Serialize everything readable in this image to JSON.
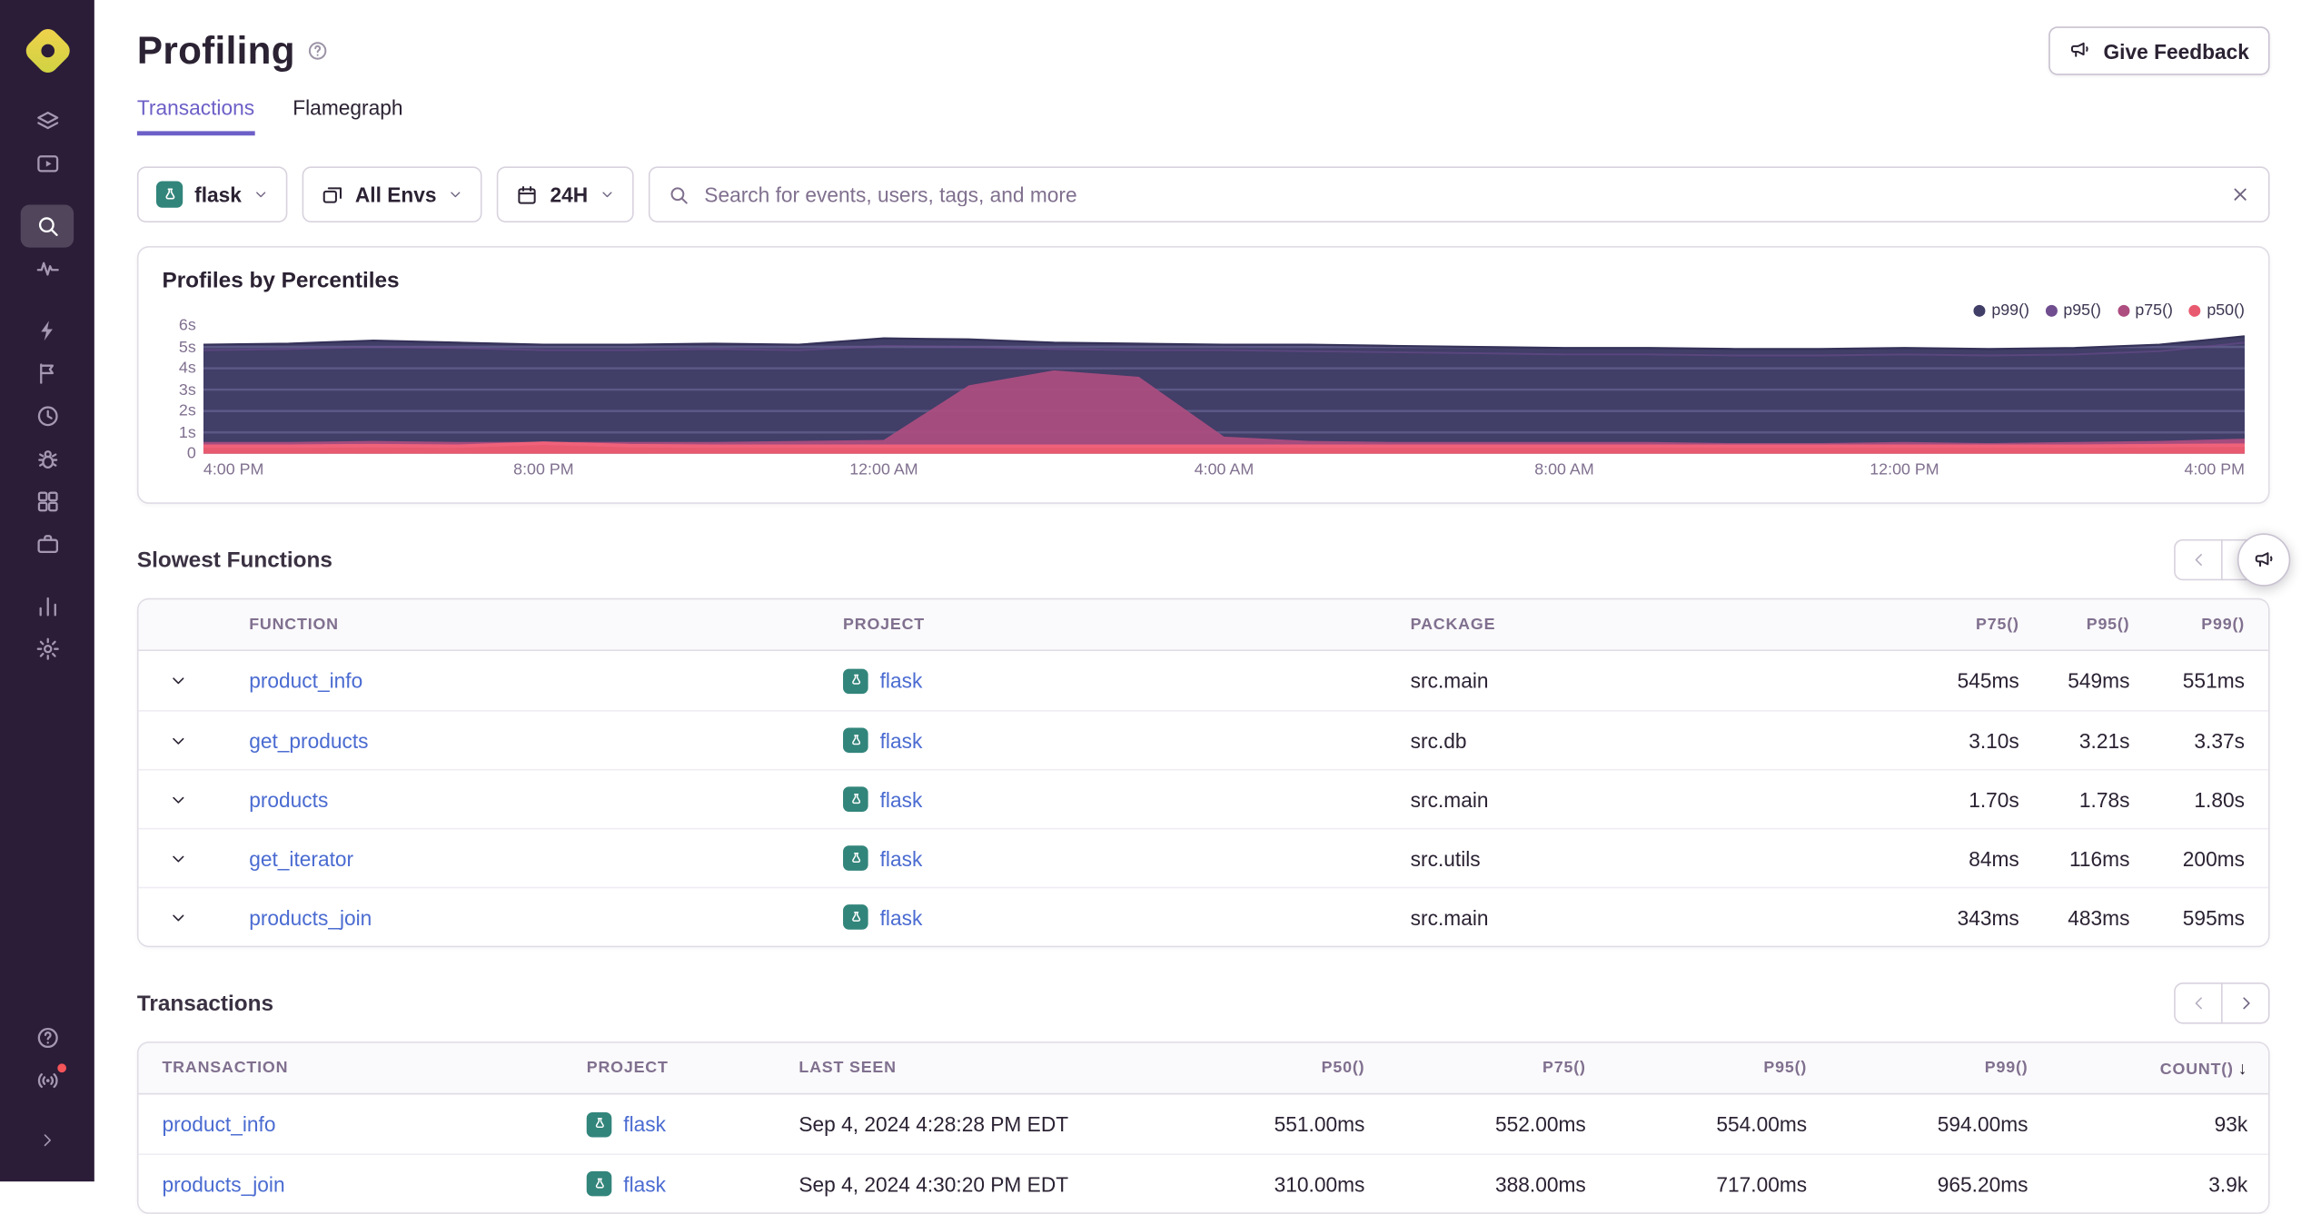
{
  "colors": {
    "accent_purple": "#6C5FC7",
    "link_blue": "#4a6bd1",
    "flask_teal": "#32857b",
    "sidebar_bg": "#2b1d38",
    "alert_red": "#f55459"
  },
  "sidebar": {
    "active_item": "search",
    "items": [
      {
        "name": "issues",
        "icon": "layers-icon"
      },
      {
        "name": "explore",
        "icon": "monitor-play-icon"
      },
      {
        "name": "search",
        "icon": "search-icon"
      },
      {
        "name": "traces",
        "icon": "waveform-icon"
      },
      {
        "name": "alerts",
        "icon": "lightning-icon"
      },
      {
        "name": "feedback",
        "icon": "flag-icon"
      },
      {
        "name": "crons",
        "icon": "clock-icon"
      },
      {
        "name": "debug",
        "icon": "bug-icon"
      },
      {
        "name": "dashboards",
        "icon": "grid-icon"
      },
      {
        "name": "projects",
        "icon": "briefcase-icon"
      },
      {
        "name": "stats",
        "icon": "bar-chart-icon"
      },
      {
        "name": "settings",
        "icon": "gear-icon"
      }
    ],
    "bottom_items": [
      {
        "name": "help",
        "icon": "question-circle-icon"
      },
      {
        "name": "whats-new",
        "icon": "broadcast-icon",
        "has_badge": true
      },
      {
        "name": "collapse",
        "icon": "chevron-right-icon"
      }
    ]
  },
  "header": {
    "title": "Profiling",
    "feedback_button_label": "Give Feedback"
  },
  "tabs": {
    "items": [
      {
        "label": "Transactions",
        "active": true
      },
      {
        "label": "Flamegraph",
        "active": false
      }
    ]
  },
  "filters": {
    "project_selector": {
      "value": "flask",
      "icon": "flask-project-icon"
    },
    "environment_selector": {
      "value": "All Envs",
      "icon": "windows-icon"
    },
    "date_selector": {
      "value": "24H",
      "icon": "calendar-icon"
    },
    "search": {
      "placeholder": "Search for events, users, tags, and more"
    }
  },
  "profiles_panel": {
    "title": "Profiles by Percentiles",
    "legend": [
      {
        "label": "p99()",
        "color": "#413E68"
      },
      {
        "label": "p95()",
        "color": "#6F4D8F"
      },
      {
        "label": "p75()",
        "color": "#AD4D80"
      },
      {
        "label": "p50()",
        "color": "#E85A6F"
      }
    ]
  },
  "chart_data": {
    "type": "area",
    "title": "Profiles by Percentiles",
    "x_ticks": [
      "4:00 PM",
      "8:00 PM",
      "12:00 AM",
      "4:00 AM",
      "8:00 AM",
      "12:00 PM",
      "4:00 PM"
    ],
    "y_ticks": [
      "6s",
      "5s",
      "4s",
      "3s",
      "2s",
      "1s",
      "0"
    ],
    "ylim_seconds": [
      0,
      6
    ],
    "x_unit": "hours, hourly samples over 24h",
    "series": [
      {
        "name": "p99()",
        "color": "#413E68",
        "unit": "s",
        "values": [
          5.1,
          5.15,
          5.3,
          5.2,
          5.1,
          5.1,
          5.15,
          5.1,
          5.4,
          5.35,
          5.2,
          5.15,
          5.1,
          5.1,
          5.05,
          5.0,
          4.95,
          4.95,
          4.9,
          4.9,
          4.95,
          4.9,
          4.95,
          5.1,
          5.5
        ]
      },
      {
        "name": "p95()",
        "color": "#6F4D8F",
        "unit": "s",
        "values": [
          4.85,
          4.9,
          5.0,
          4.95,
          4.85,
          4.85,
          4.9,
          4.85,
          5.05,
          5.0,
          4.9,
          4.85,
          4.85,
          4.8,
          4.75,
          4.7,
          4.65,
          4.65,
          4.6,
          4.6,
          4.65,
          4.6,
          4.65,
          4.8,
          5.2
        ]
      },
      {
        "name": "p75()",
        "color": "#AD4D80",
        "unit": "s",
        "values": [
          0.55,
          0.55,
          0.6,
          0.55,
          0.55,
          0.55,
          0.55,
          0.6,
          0.65,
          3.2,
          3.9,
          3.6,
          0.8,
          0.6,
          0.55,
          0.55,
          0.55,
          0.55,
          0.5,
          0.5,
          0.55,
          0.5,
          0.55,
          0.6,
          0.7
        ]
      },
      {
        "name": "p50()",
        "color": "#E85A6F",
        "unit": "s",
        "values": [
          0.35,
          0.35,
          0.38,
          0.35,
          0.5,
          0.38,
          0.35,
          0.35,
          0.35,
          0.35,
          0.35,
          0.35,
          0.35,
          0.35,
          0.35,
          0.35,
          0.35,
          0.35,
          0.35,
          0.35,
          0.35,
          0.35,
          0.35,
          0.38,
          0.4
        ]
      }
    ],
    "legend_position": "top-right",
    "grid": false
  },
  "slowest_functions": {
    "title": "Slowest Functions",
    "columns": [
      "FUNCTION",
      "PROJECT",
      "PACKAGE",
      "P75()",
      "P95()",
      "P99()"
    ],
    "rows": [
      {
        "function": "product_info",
        "project": "flask",
        "package": "src.main",
        "p75": "545ms",
        "p95": "549ms",
        "p99": "551ms"
      },
      {
        "function": "get_products",
        "project": "flask",
        "package": "src.db",
        "p75": "3.10s",
        "p95": "3.21s",
        "p99": "3.37s"
      },
      {
        "function": "products",
        "project": "flask",
        "package": "src.main",
        "p75": "1.70s",
        "p95": "1.78s",
        "p99": "1.80s"
      },
      {
        "function": "get_iterator",
        "project": "flask",
        "package": "src.utils",
        "p75": "84ms",
        "p95": "116ms",
        "p99": "200ms"
      },
      {
        "function": "products_join",
        "project": "flask",
        "package": "src.main",
        "p75": "343ms",
        "p95": "483ms",
        "p99": "595ms"
      }
    ]
  },
  "transactions": {
    "title": "Transactions",
    "columns": [
      "TRANSACTION",
      "PROJECT",
      "LAST SEEN",
      "P50()",
      "P75()",
      "P95()",
      "P99()",
      "COUNT()"
    ],
    "sort_indicator": "↓",
    "rows": [
      {
        "transaction": "product_info",
        "project": "flask",
        "last_seen": "Sep 4, 2024 4:28:28 PM EDT",
        "p50": "551.00ms",
        "p75": "552.00ms",
        "p95": "554.00ms",
        "p99": "594.00ms",
        "count": "93k"
      },
      {
        "transaction": "products_join",
        "project": "flask",
        "last_seen": "Sep 4, 2024 4:30:20 PM EDT",
        "p50": "310.00ms",
        "p75": "388.00ms",
        "p95": "717.00ms",
        "p99": "965.20ms",
        "count": "3.9k"
      }
    ]
  }
}
